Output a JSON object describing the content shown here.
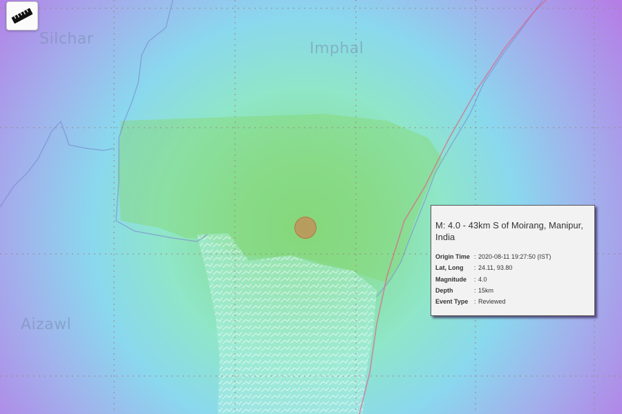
{
  "map": {
    "cities": [
      {
        "name": "Silchar"
      },
      {
        "name": "Imphal"
      },
      {
        "name": "Aizawl"
      }
    ],
    "toolbar": {
      "ruler_icon": "ruler-icon"
    },
    "colors": {
      "intensity_high": "#86d880",
      "intensity_mid": "#8fe6c0",
      "intensity_low": "#8ad8f0",
      "intensity_outer": "#b48ae6",
      "border_line": "#d96a8a",
      "epicenter": "#e06e46"
    }
  },
  "popup": {
    "title": "M: 4.0 - 43km S of Moirang, Manipur, India",
    "rows": [
      {
        "label": "Origin Time",
        "sep": ":",
        "value": "2020-08-11 19:27:50 (IST)"
      },
      {
        "label": "Lat, Long",
        "sep": ":",
        "value": "24.11, 93.80"
      },
      {
        "label": "Magnitude",
        "sep": ":",
        "value": "4.0"
      },
      {
        "label": "Depth",
        "sep": ":",
        "value": "15km"
      },
      {
        "label": "Event Type",
        "sep": ":",
        "value": "Reviewed"
      }
    ]
  }
}
